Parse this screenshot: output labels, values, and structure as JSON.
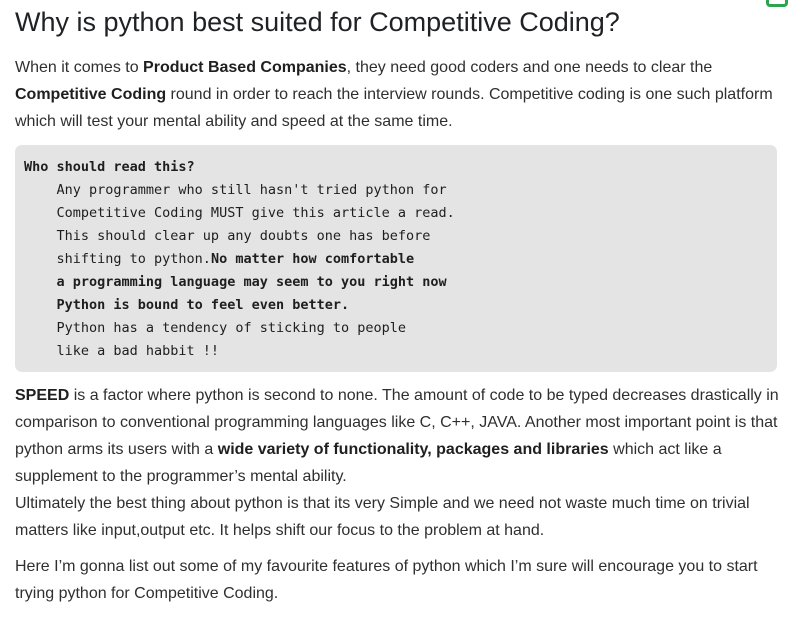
{
  "article": {
    "title": "Why is python best suited for Competitive Coding?",
    "intro": {
      "t1": "When it comes to ",
      "b1": "Product Based Companies",
      "t2": ", they need good coders and one needs to clear the ",
      "b2": "Competitive Coding",
      "t3": " round in order to reach the interview rounds. Competitive coding is one such platform which will test your mental ability and speed at the same time."
    },
    "code_block": {
      "heading": "Who should read this?",
      "line1": "    Any programmer who still hasn't tried python for",
      "line2": "    Competitive Coding MUST give this article a read.",
      "line3": "    This should clear up any doubts one has before",
      "line4_plain": "    shifting to python.",
      "line4_bold": "No matter how comfortable",
      "line5_bold": "    a programming language may seem to you right now",
      "line6_bold": "    Python is bound to feel even better.",
      "line7": "    Python has a tendency of sticking to people",
      "line8": "    like a bad habbit !!"
    },
    "speed": {
      "b1": "SPEED",
      "t1": " is a factor where python is second to none. The amount of code to be typed decreases drastically in comparison to conventional programming languages like C, C++, JAVA. Another most important point is that python arms its users with a ",
      "b2": "wide variety of functionality, packages and libraries",
      "t2": " which act like a supplement to the programmer’s mental ability.",
      "t3": "Ultimately the best thing about python is that its very Simple and we need not waste much time on trivial matters like input,output etc. It helps shift our focus to the problem at hand."
    },
    "outro": "Here I’m gonna list out some of my favourite features of python which I’m sure will encourage you to start trying python for Competitive Coding."
  },
  "colors": {
    "accent": "#2ca44e",
    "code_bg": "#e4e4e4",
    "text": "#2f2f2f"
  },
  "icons": [
    "bookmark-icon"
  ]
}
